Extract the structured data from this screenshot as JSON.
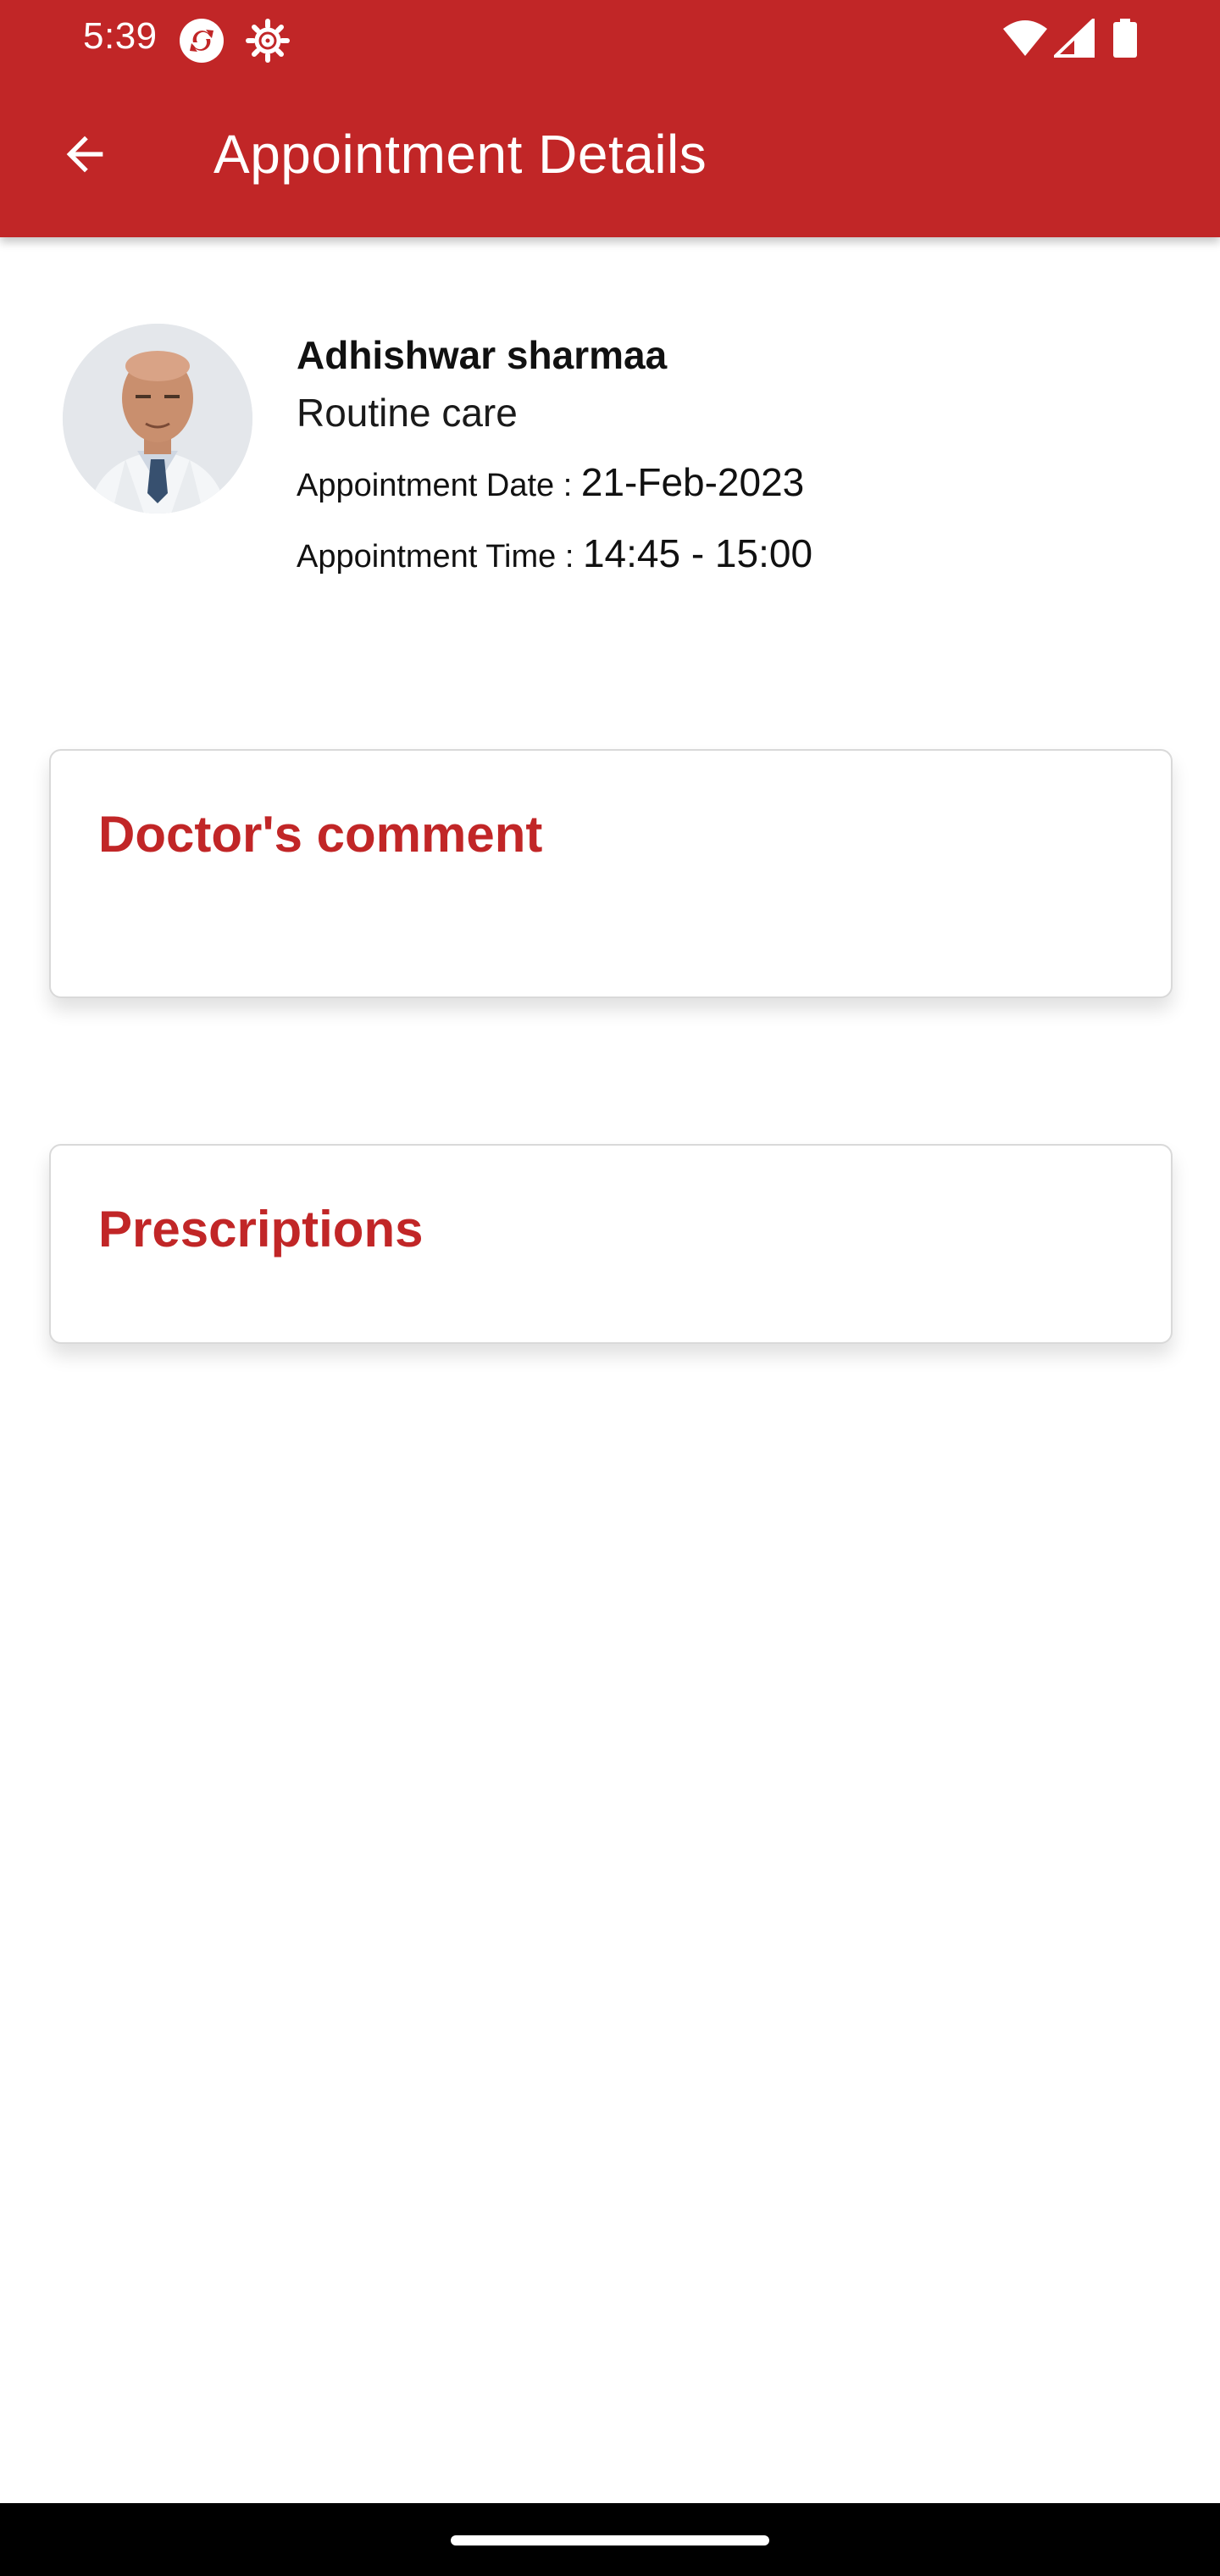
{
  "status_bar": {
    "time": "5:39",
    "left_icons": [
      "sync-app-icon",
      "gear-notification-icon"
    ],
    "right_icons": [
      "wifi-icon",
      "cellular-signal-icon",
      "battery-icon"
    ]
  },
  "toolbar": {
    "title": "Appointment Details",
    "back_icon": "arrow-left-icon"
  },
  "doctor": {
    "name": "Adhishwar sharmaa",
    "visit_type": "Routine care",
    "date_label": "Appointment Date : ",
    "date_value": "21-Feb-2023",
    "time_label": "Appointment Time : ",
    "time_value": "14:45 - 15:00"
  },
  "cards": {
    "comment_title": "Doctor's comment",
    "prescriptions_title": "Prescriptions"
  },
  "colors": {
    "primary": "#c12627",
    "background": "#ffffff",
    "text": "#111111"
  }
}
